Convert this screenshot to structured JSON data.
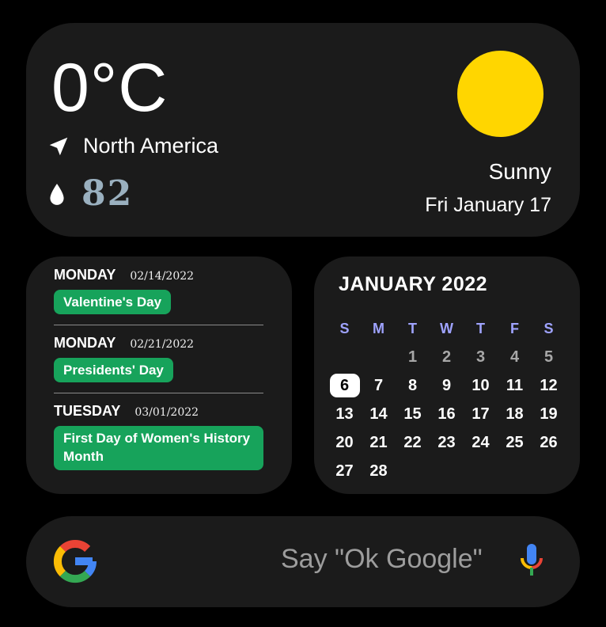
{
  "weather": {
    "temperature": "0°C",
    "location": "North America",
    "humidity": "82",
    "condition": "Sunny",
    "date": "Fri January 17",
    "icons": {
      "location": "navigation-arrow-icon",
      "humidity": "water-drop-icon",
      "sun": "sun-icon"
    },
    "colors": {
      "sun": "#ffd600"
    }
  },
  "events": [
    {
      "day": "MONDAY",
      "date": "02/14/2022",
      "title": "Valentine's Day"
    },
    {
      "day": "MONDAY",
      "date": "02/21/2022",
      "title": "Presidents' Day"
    },
    {
      "day": "TUESDAY",
      "date": "03/01/2022",
      "title": "First Day of Women's History Month"
    }
  ],
  "calendar": {
    "title": "JANUARY 2022",
    "weekdays": [
      "S",
      "M",
      "T",
      "W",
      "T",
      "F",
      "S"
    ],
    "weeks": [
      [
        "",
        "",
        "1",
        "2",
        "3",
        "4",
        "5"
      ],
      [
        "6",
        "7",
        "8",
        "9",
        "10",
        "11",
        "12"
      ],
      [
        "13",
        "14",
        "15",
        "16",
        "17",
        "18",
        "19"
      ],
      [
        "20",
        "21",
        "22",
        "23",
        "24",
        "25",
        "26"
      ],
      [
        "27",
        "28",
        "",
        "",
        "",
        "",
        ""
      ]
    ],
    "today": "6",
    "colors": {
      "weekday": "#9fa3ff",
      "event_pill": "#17a35b"
    }
  },
  "search": {
    "placeholder": "Say \"Ok Google\"",
    "icons": {
      "logo": "google-logo-icon",
      "mic": "microphone-icon"
    }
  }
}
